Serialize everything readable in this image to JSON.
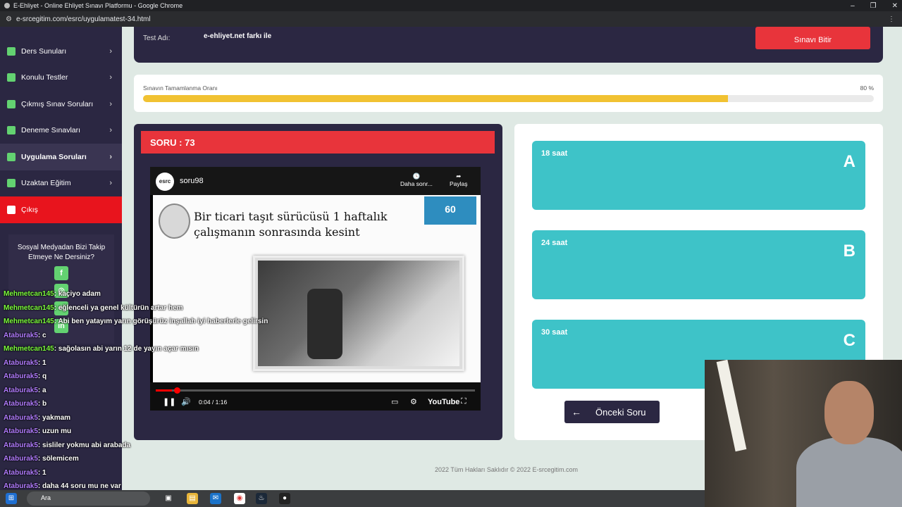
{
  "browser": {
    "title": "E-Ehliyet - Online Ehliyet Sınavı Platformu - Google Chrome",
    "url": "e-srcegitim.com/esrc/uygulamatest-34.html"
  },
  "sidebar": {
    "items": [
      {
        "label": "Ders Sunuları"
      },
      {
        "label": "Konulu Testler"
      },
      {
        "label": "Çıkmış Sınav Soruları"
      },
      {
        "label": "Deneme Sınavları"
      },
      {
        "label": "Uygulama Soruları"
      },
      {
        "label": "Uzaktan Eğitim"
      },
      {
        "label": "Çıkış"
      }
    ],
    "social_text": "Sosyal Medyadan Bizi Takip Etmeye Ne Dersiniz?"
  },
  "test": {
    "name_label": "Test Adı:",
    "name_value": "e-ehliyet.net farkı ile",
    "finish_label": "Sınavı Bitir"
  },
  "progress": {
    "label": "Sınavın Tamamlanma Oranı",
    "value_text": "80 %",
    "fraction": 0.8,
    "color": "#f1c232"
  },
  "question": {
    "header": "SORU : 73",
    "video": {
      "channel": "soru98",
      "later_label": "Daha sonr...",
      "share_label": "Paylaş",
      "question_text": "Bir ticari taşıt sürücüsü 1 haftalık çalışmanın sonrasında kesint",
      "badge": "60",
      "time": "0:04 / 1:16",
      "progress_fraction": 0.05,
      "youtube_label": "YouTube"
    }
  },
  "choices": [
    {
      "text": "18 saat",
      "letter": "A"
    },
    {
      "text": "24 saat",
      "letter": "B"
    },
    {
      "text": "30 saat",
      "letter": "C"
    }
  ],
  "prev_button": "Önceki Soru",
  "footer": "2022 Tüm Hakları Saklıdır © 2022 E-srcegitim.com",
  "chat": [
    {
      "user": "Mehmetcan145",
      "msg": ": kaçiyo adam",
      "color": "#7cfc3c"
    },
    {
      "user": "Mehmetcan145",
      "msg": ": eğlenceli ya genel kültürün artar hem",
      "color": "#7cfc3c"
    },
    {
      "user": "Mehmetcan145",
      "msg": ": Abi ben yatayım yarın görüşürüz inşallah iyi haberlerle gelirsin",
      "color": "#7cfc3c"
    },
    {
      "user": "Ataburak5",
      "msg": ": c",
      "color": "#b27cff"
    },
    {
      "user": "Mehmetcan145",
      "msg": ": sağolasın abi yarın 12 de yayın açar mısın",
      "color": "#7cfc3c"
    },
    {
      "user": "Ataburak5",
      "msg": ": 1",
      "color": "#b27cff"
    },
    {
      "user": "Ataburak5",
      "msg": ": q",
      "color": "#b27cff"
    },
    {
      "user": "Ataburak5",
      "msg": ": a",
      "color": "#b27cff"
    },
    {
      "user": "Ataburak5",
      "msg": ": b",
      "color": "#b27cff"
    },
    {
      "user": "Ataburak5",
      "msg": ": yakmam",
      "color": "#b27cff"
    },
    {
      "user": "Ataburak5",
      "msg": ": uzun mu",
      "color": "#b27cff"
    },
    {
      "user": "Ataburak5",
      "msg": ": sisliler yokmu abi arabada",
      "color": "#b27cff"
    },
    {
      "user": "Ataburak5",
      "msg": ": sölemicem",
      "color": "#b27cff"
    },
    {
      "user": "Ataburak5",
      "msg": ": 1",
      "color": "#b27cff"
    },
    {
      "user": "Ataburak5",
      "msg": ": daha 44 soru mu ne var",
      "color": "#b27cff"
    }
  ],
  "taskbar": {
    "search_placeholder": "Ara"
  }
}
